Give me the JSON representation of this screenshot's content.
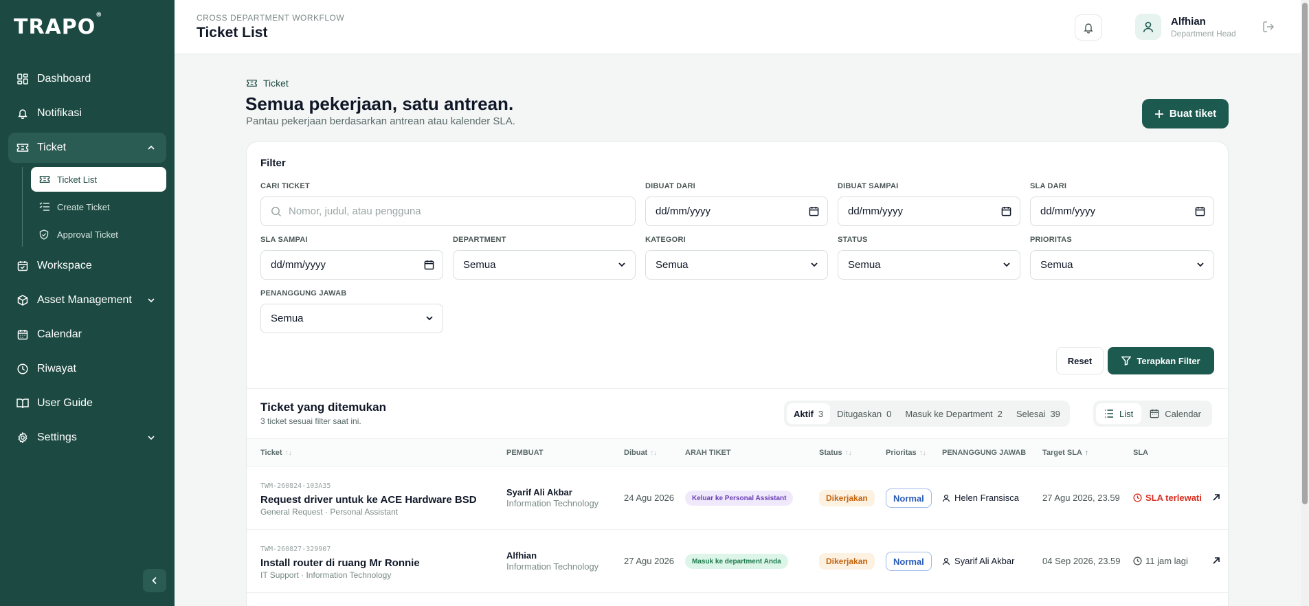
{
  "brand": {
    "logo": "TRAPO",
    "mark": "®"
  },
  "sidebar": {
    "items": [
      {
        "label": "Dashboard"
      },
      {
        "label": "Notifikasi"
      },
      {
        "label": "Ticket"
      },
      {
        "label": "Workspace"
      },
      {
        "label": "Asset Management"
      },
      {
        "label": "Calendar"
      },
      {
        "label": "Riwayat"
      },
      {
        "label": "User Guide"
      },
      {
        "label": "Settings"
      }
    ],
    "ticket_sub": [
      {
        "label": "Ticket List"
      },
      {
        "label": "Create Ticket"
      },
      {
        "label": "Approval Ticket"
      }
    ]
  },
  "header": {
    "breadcrumb": "CROSS DEPARTMENT WORKFLOW",
    "title": "Ticket List",
    "user_name": "Alfhian",
    "user_role": "Department Head"
  },
  "page": {
    "tag": "Ticket",
    "heading": "Semua pekerjaan, satu antrean.",
    "subheading": "Pantau pekerjaan berdasarkan antrean atau kalender SLA.",
    "create_label": "Buat tiket"
  },
  "filter": {
    "title": "Filter",
    "search_label": "CARI TICKET",
    "search_placeholder": "Nomor, judul, atau pengguna",
    "created_from_label": "DIBUAT DARI",
    "created_to_label": "DIBUAT SAMPAI",
    "sla_from_label": "SLA DARI",
    "sla_to_label": "SLA SAMPAI",
    "department_label": "DEPARTMENT",
    "category_label": "KATEGORI",
    "status_label": "STATUS",
    "priority_label": "PRIORITAS",
    "pic_label": "PENANGGUNG JAWAB",
    "date_placeholder": "dd/mm/yyyy",
    "select_value": "Semua",
    "reset_label": "Reset",
    "apply_label": "Terapkan Filter"
  },
  "results": {
    "title": "Ticket yang ditemukan",
    "subtitle": "3 ticket sesuai filter saat ini.",
    "tabs": [
      {
        "label": "Aktif",
        "count": "3"
      },
      {
        "label": "Ditugaskan",
        "count": "0"
      },
      {
        "label": "Masuk ke Department",
        "count": "2"
      },
      {
        "label": "Selesai",
        "count": "39"
      }
    ],
    "views": [
      {
        "label": "List"
      },
      {
        "label": "Calendar"
      }
    ]
  },
  "table": {
    "columns": [
      "Ticket",
      "PEMBUAT",
      "Dibuat",
      "ARAH TIKET",
      "Status",
      "Prioritas",
      "PENANGGUNG JAWAB",
      "Target SLA",
      "SLA"
    ],
    "rows": [
      {
        "code": "TWM-260824-103A35",
        "title": "Request driver untuk ke ACE Hardware BSD",
        "meta": "General Request · Personal Assistant",
        "creator": "Syarif Ali Akbar",
        "creator_dept": "Information Technology",
        "created": "24 Agu 2026",
        "direction": "Keluar ke Personal Assistant",
        "status": "Dikerjakan",
        "priority": "Normal",
        "pic": "Helen Fransisca",
        "target_sla": "27 Agu 2026, 23.59",
        "sla": "SLA terlewati"
      },
      {
        "code": "TWM-260827-329907",
        "title": "Install router di ruang Mr Ronnie",
        "meta": "IT Support · Information Technology",
        "creator": "Alfhian",
        "creator_dept": "Information Technology",
        "created": "27 Agu 2026",
        "direction": "Masuk ke department Anda",
        "status": "Dikerjakan",
        "priority": "Normal",
        "pic": "Syarif Ali Akbar",
        "target_sla": "04 Sep 2026, 23.59",
        "sla": "11 jam lagi"
      }
    ]
  },
  "colors": {
    "sidebar_bg": "#1c4a42",
    "primary": "#1c5a50",
    "sla_late": "#d92d20"
  }
}
